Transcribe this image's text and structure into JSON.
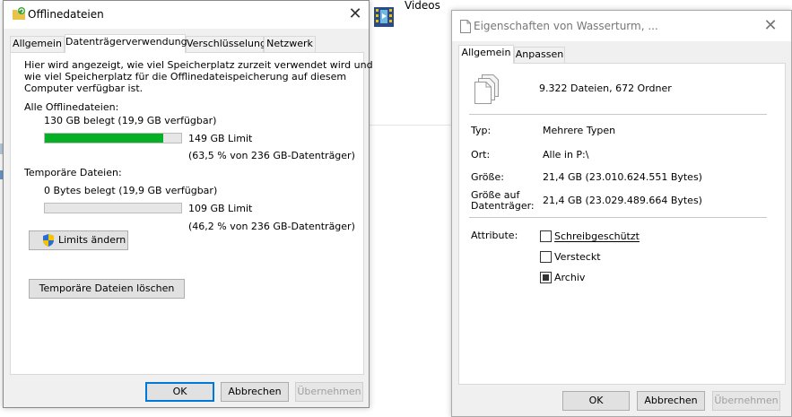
{
  "background": {
    "videos_label": "Videos"
  },
  "offline_dialog": {
    "title": "Offlinedateien",
    "tabs": [
      "Allgemein",
      "Datenträgerverwendung",
      "Verschlüsselung",
      "Netzwerk"
    ],
    "active_tab": "Datenträgerverwendung",
    "description_lines": [
      "Hier wird angezeigt, wie viel Speicherplatz zurzeit verwendet wird und",
      "wie viel Speicherplatz für die Offlinedateispeicherung auf diesem",
      "Computer verfügbar ist."
    ],
    "all_files": {
      "heading": "Alle Offlinedateien:",
      "used": "130 GB belegt (19,9 GB verfügbar)",
      "limit": "149 GB Limit",
      "percent_text": "(63,5 % von 236 GB-Datenträger)",
      "usage_fraction": 0.87
    },
    "temp_files": {
      "heading": "Temporäre Dateien:",
      "used": "0 Bytes belegt (19,9 GB verfügbar)",
      "limit": "109 GB Limit",
      "percent_text": "(46,2 % von 236 GB-Datenträger)",
      "usage_fraction": 0
    },
    "change_limits_button": "Limits ändern",
    "delete_temp_button": "Temporäre Dateien löschen",
    "ok_button": "OK",
    "cancel_button": "Abbrechen",
    "apply_button": "Übernehmen",
    "colors": {
      "bar_fill": "#06b025",
      "default_button_border": "#0078d7"
    }
  },
  "properties_dialog": {
    "title": "Eigenschaften von Wasserturm, ...",
    "tabs": [
      "Allgemein",
      "Anpassen"
    ],
    "active_tab": "Allgemein",
    "summary": "9.322 Dateien, 672 Ordner",
    "rows": [
      {
        "label": "Typ:",
        "value": "Mehrere Typen"
      },
      {
        "label": "Ort:",
        "value": "Alle in P:\\"
      },
      {
        "label": "Größe:",
        "value": "21,4 GB (23.010.624.551 Bytes)"
      },
      {
        "label_line1": "Größe auf",
        "label_line2": "Datenträger:",
        "value": "21,4 GB (23.029.489.664 Bytes)"
      }
    ],
    "attributes_label": "Attribute:",
    "attributes": [
      {
        "label": "Schreibgeschützt",
        "checked": false
      },
      {
        "label": "Versteckt",
        "checked": false
      },
      {
        "label": "Archiv",
        "checked": "indeterminate"
      }
    ],
    "ok_button": "OK",
    "cancel_button": "Abbrechen",
    "apply_button": "Übernehmen"
  }
}
